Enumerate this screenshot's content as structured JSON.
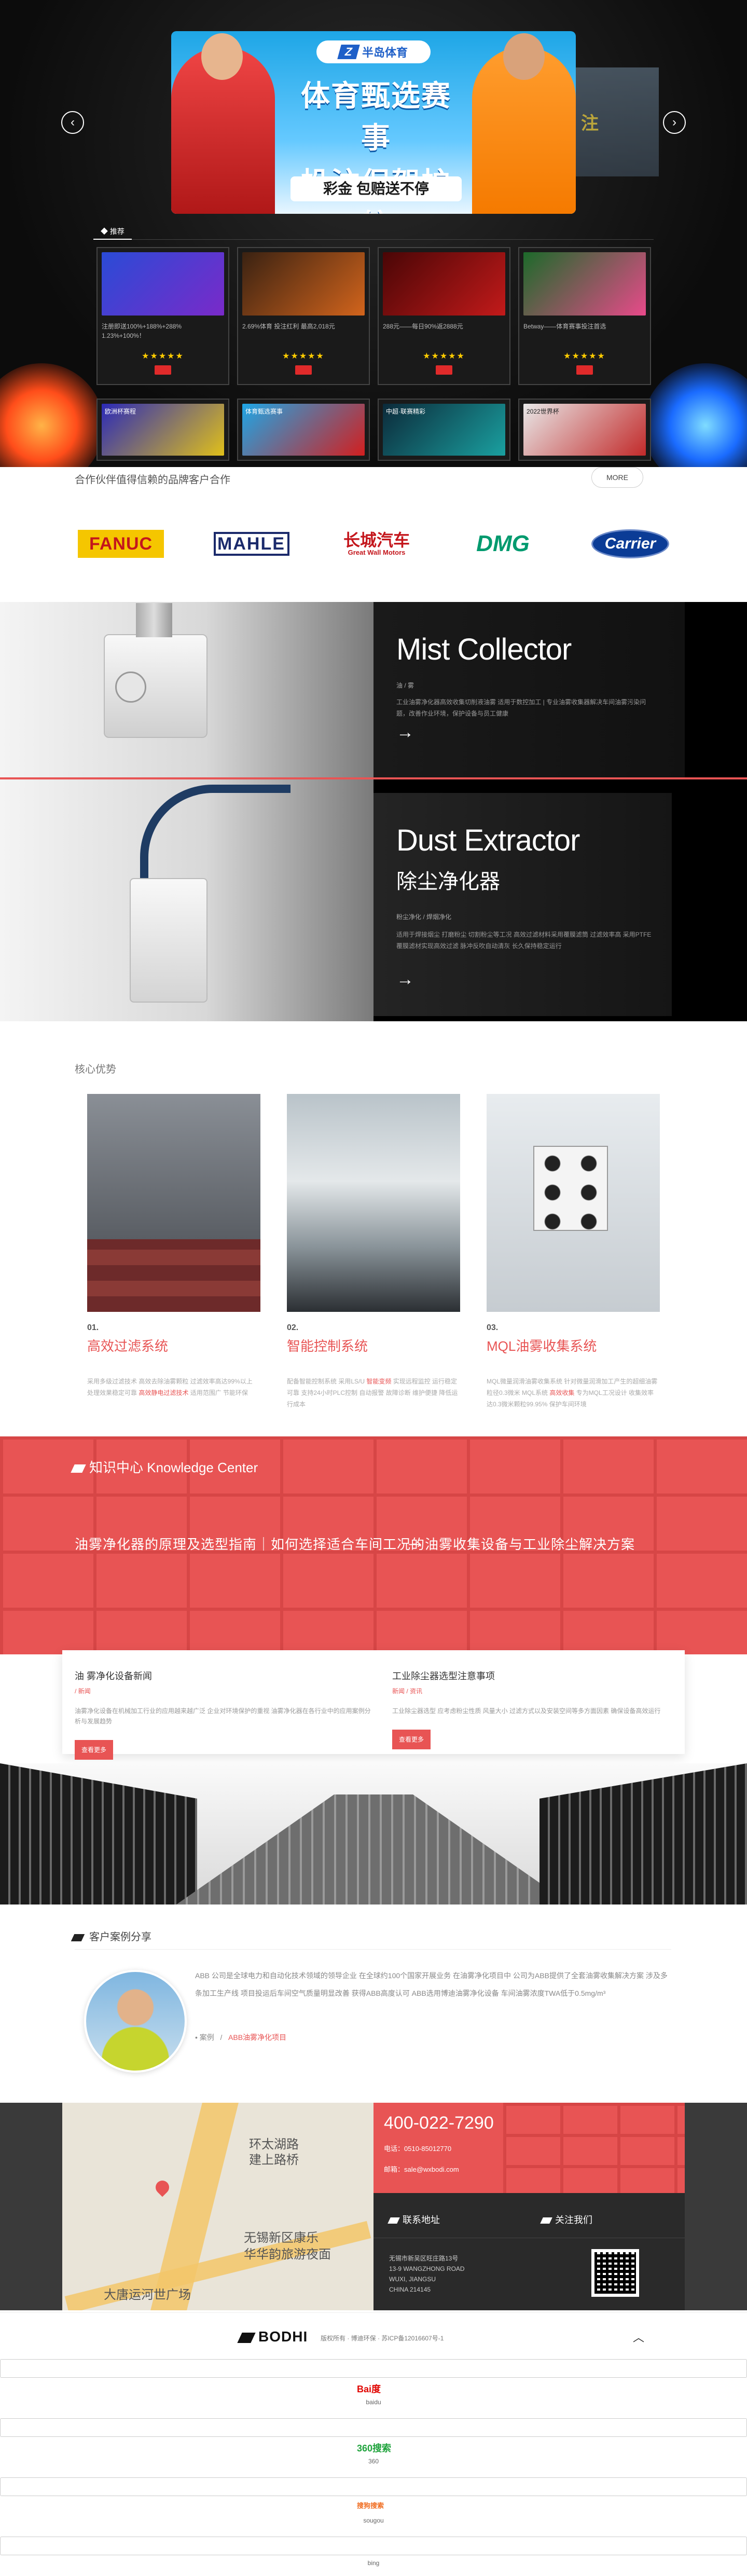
{
  "hero": {
    "brand": "半岛体育",
    "slide_title_l1": "体育甄选赛事",
    "slide_title_l2": "投注保驾护航",
    "slide_sub": "彩金 包赔送不停",
    "ghost_text": "注",
    "cards_tab": "◆ 推荐",
    "cards": [
      {
        "text": "注册即送100%+188%+288% 1.23%+100%！",
        "stars": "★★★★★"
      },
      {
        "text": "2.69%体育 投注红利 最高2,018元",
        "stars": "★★★★★"
      },
      {
        "text": "288元——每日90%返2888元",
        "stars": "★★★★★"
      },
      {
        "text": "Betway——体育赛事投注首选",
        "stars": "★★★★★"
      }
    ],
    "cards2_text": [
      "欧洲杯赛程",
      "体育甄选赛事",
      "中超·联赛精彩",
      "2022世界杯"
    ],
    "colors": {
      "accent": "#e02a2a",
      "slide_blue": "#1ea6e6"
    }
  },
  "partners": {
    "title": "合作伙伴值得信赖的品牌客户合作",
    "more": "MORE",
    "logos": [
      "FANUC",
      "MAHLE",
      "长城汽车",
      "Great Wall Motors",
      "DMG",
      "Carrier"
    ]
  },
  "products": [
    {
      "name": "Mist Collector",
      "cn": "",
      "tags": "油 / 雾",
      "desc": "工业油雾净化器高效收集切削液油雾 适用于数控加工 | 专业油雾收集器解决车间油雾污染问题，改善作业环境，保护设备与员工健康",
      "arrow": "→"
    },
    {
      "name": "Dust Extractor",
      "cn": "除尘净化器",
      "tags": "粉尘净化 / 焊烟净化",
      "desc": "适用于焊接烟尘 打磨粉尘 切割粉尘等工况 高效过滤材料采用覆膜滤筒 过滤效率高 采用PTFE覆膜滤材实现高效过滤 脉冲反吹自动清灰 长久保持稳定运行",
      "arrow": "→"
    }
  ],
  "advantages": {
    "title": "核心优势",
    "items": [
      {
        "num": "01.",
        "name": "高效过滤系统",
        "desc": "采用多级过滤技术 高效去除油雾颗粒 过滤效率高达99%以上 处理效果稳定可靠 ",
        "highlight": "高效静电过滤技术",
        "desc2": " 适用范围广 节能环保"
      },
      {
        "num": "02.",
        "name": "智能控制系统",
        "desc": "配备智能控制系统 采用LS/U ",
        "highlight": "智能变频",
        "desc2": " 实现远程监控 运行稳定可靠 支持24小时PLC控制 自动报警 故障诊断 维护便捷 降低运行成本"
      },
      {
        "num": "03.",
        "name": "MQL油雾收集系统",
        "desc": "MQL微量润滑油雾收集系统 针对微量润滑加工产生的超细油雾 粒径0.3微米 MQL系统 ",
        "highlight": "高效收集",
        "desc2": " 专为MQL工况设计 收集效率达0.3微米颗粒99.95% 保护车间环境"
      }
    ]
  },
  "knowledge": {
    "title": "知识中心 Knowledge Center",
    "text": "油雾净化器的原理及选型指南｜如何选择适合车间工况的油雾收集设备与工业除尘解决方案",
    "arrow": "→"
  },
  "news": [
    {
      "title": "油 雾净化设备新闻",
      "meta": "/ 新闻",
      "desc": "油雾净化设备在机械加工行业的应用越来越广泛 企业对环境保护的重视 油雾净化器在各行业中的应用案例分析与发展趋势",
      "btn": "查看更多"
    },
    {
      "title": "工业除尘器选型注意事项",
      "meta": "新闻 / 资讯",
      "desc": "工业除尘器选型 应考虑粉尘性质 风量大小 过滤方式以及安装空间等多方面因素 确保设备高效运行",
      "btn": "查看更多"
    }
  ],
  "case": {
    "title": "客户案例分享",
    "text": "ABB 公司是全球电力和自动化技术领域的领导企业 在全球约100个国家开展业务 在油雾净化项目中 公司为ABB提供了全套油雾收集解决方案 涉及多条加工生产线 项目投运后车间空气质量明显改善 获得ABB高度认可 ABB选用博迪油雾净化设备 车间油雾浓度TWA低于0.5mg/m³",
    "meta_prefix": "• 案例",
    "meta_sep": "/",
    "meta_link": "ABB油雾净化项目"
  },
  "contact": {
    "phone": "400-022-7290",
    "tel": "电话：0510-85012770",
    "email": "邮箱：sale@wxbodi.com",
    "address_head": "联系地址",
    "follow_head": "关注我们",
    "address_lines": [
      "无锡市新吴区旺庄路13号",
      "13-9 WANGZHONG ROAD",
      "WUXI, JIANGSU",
      "CHINA 214145"
    ],
    "map_labels": [
      "环太湖路",
      "建上路桥",
      "无锡新区康乐",
      "华华韵旅游夜面",
      "大唐运河世广场"
    ]
  },
  "footer": {
    "logo": "BODHI",
    "copy": "版权所有 · 博迪环保 · 苏ICP备12016607号-1",
    "up": "︿"
  },
  "share": [
    {
      "icon": "Bai度",
      "label": "baidu",
      "color": "#e10602"
    },
    {
      "icon": "360搜索",
      "label": "360",
      "color": "#1fa33c"
    },
    {
      "icon": "搜狗搜索",
      "label": "sougou",
      "color": "#f06b1e"
    },
    {
      "icon": "",
      "label": "bing",
      "color": "#f06b1e"
    }
  ]
}
